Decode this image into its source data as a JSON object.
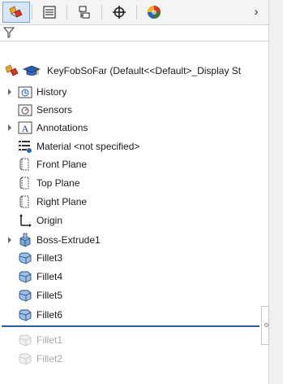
{
  "tabs": [
    {
      "name": "featuremanager-tab",
      "icon": "featuremanager-icon",
      "active": true
    },
    {
      "name": "propertymanager-tab",
      "icon": "propertymanager-icon",
      "active": false
    },
    {
      "name": "configurationmanager-tab",
      "icon": "configurationmanager-icon",
      "active": false
    },
    {
      "name": "dimxpertmanager-tab",
      "icon": "crosshair-icon",
      "active": false
    },
    {
      "name": "displaymanager-tab",
      "icon": "displaymanager-icon",
      "active": false
    }
  ],
  "more_label": "›",
  "tree": {
    "root_label": "KeyFobSoFar  (Default<<Default>_Display St",
    "items": [
      {
        "label": "History",
        "icon": "history-folder-icon",
        "expandable": true
      },
      {
        "label": "Sensors",
        "icon": "sensors-folder-icon",
        "expandable": false
      },
      {
        "label": "Annotations",
        "icon": "annotations-icon",
        "expandable": true
      },
      {
        "label": "Material <not specified>",
        "icon": "material-icon",
        "expandable": false
      },
      {
        "label": "Front Plane",
        "icon": "plane-icon",
        "expandable": false
      },
      {
        "label": "Top Plane",
        "icon": "plane-icon",
        "expandable": false
      },
      {
        "label": "Right Plane",
        "icon": "plane-icon",
        "expandable": false
      },
      {
        "label": "Origin",
        "icon": "origin-icon",
        "expandable": false
      },
      {
        "label": "Boss-Extrude1",
        "icon": "boss-extrude-icon",
        "expandable": true
      },
      {
        "label": "Fillet3",
        "icon": "fillet-icon",
        "expandable": false
      },
      {
        "label": "Fillet4",
        "icon": "fillet-icon",
        "expandable": false
      },
      {
        "label": "Fillet5",
        "icon": "fillet-icon",
        "expandable": false
      },
      {
        "label": "Fillet6",
        "icon": "fillet-icon",
        "expandable": false
      },
      {
        "label": "Fillet1",
        "icon": "fillet-icon",
        "expandable": false,
        "suppressed": true
      },
      {
        "label": "Fillet2",
        "icon": "fillet-icon",
        "expandable": false,
        "suppressed": true
      }
    ]
  },
  "colors": {
    "active_tab_bg": "#d6e6f7",
    "rollback_bar": "#2b5da6",
    "suppressed_text": "#a8a8a8"
  }
}
